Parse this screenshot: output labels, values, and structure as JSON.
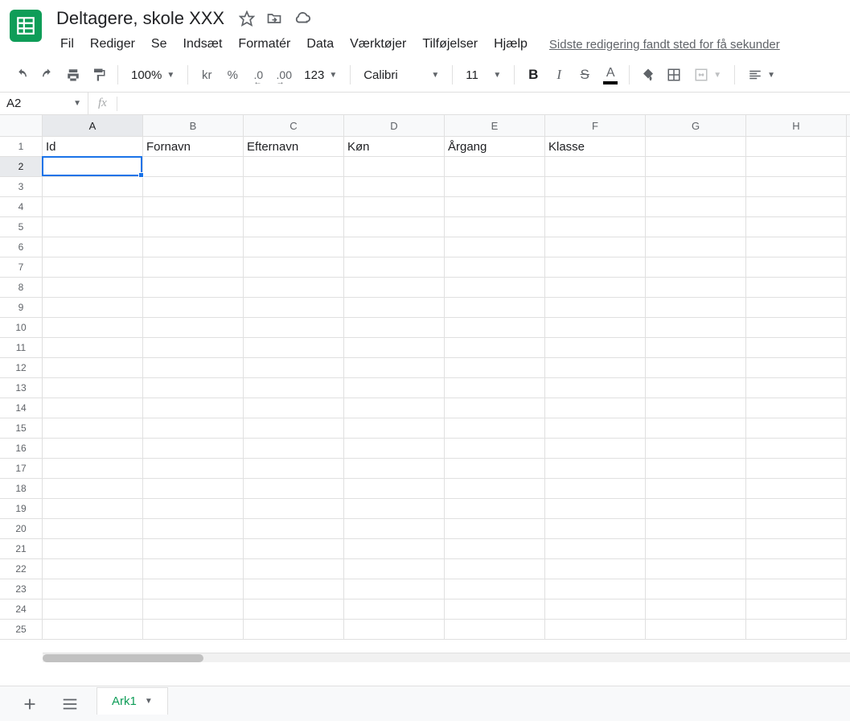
{
  "doc": {
    "title": "Deltagere, skole XXX"
  },
  "menus": {
    "file": "Fil",
    "edit": "Rediger",
    "view": "Se",
    "insert": "Indsæt",
    "format": "Formatér",
    "data": "Data",
    "tools": "Værktøjer",
    "addons": "Tilføjelser",
    "help": "Hjælp",
    "last_edit": "Sidste redigering fandt sted for få sekunder"
  },
  "toolbar": {
    "zoom": "100%",
    "currency": "kr",
    "percent": "%",
    "dec_dec": ".0",
    "inc_dec": ".00",
    "num_format": "123",
    "font": "Calibri",
    "font_size": "11"
  },
  "namebox": {
    "value": "A2",
    "fx": "fx"
  },
  "columns": [
    "A",
    "B",
    "C",
    "D",
    "E",
    "F",
    "G",
    "H"
  ],
  "rows": [
    "1",
    "2",
    "3",
    "4",
    "5",
    "6",
    "7",
    "8",
    "9",
    "10",
    "11",
    "12",
    "13",
    "14",
    "15",
    "16",
    "17",
    "18",
    "19",
    "20",
    "21",
    "22",
    "23",
    "24",
    "25"
  ],
  "headers_row": [
    "Id",
    "Fornavn",
    "Efternavn",
    "Køn",
    "Årgang",
    "Klasse",
    "",
    ""
  ],
  "selected": {
    "col": 0,
    "row": 1,
    "label": "A2"
  },
  "sheet": {
    "name": "Ark1"
  }
}
